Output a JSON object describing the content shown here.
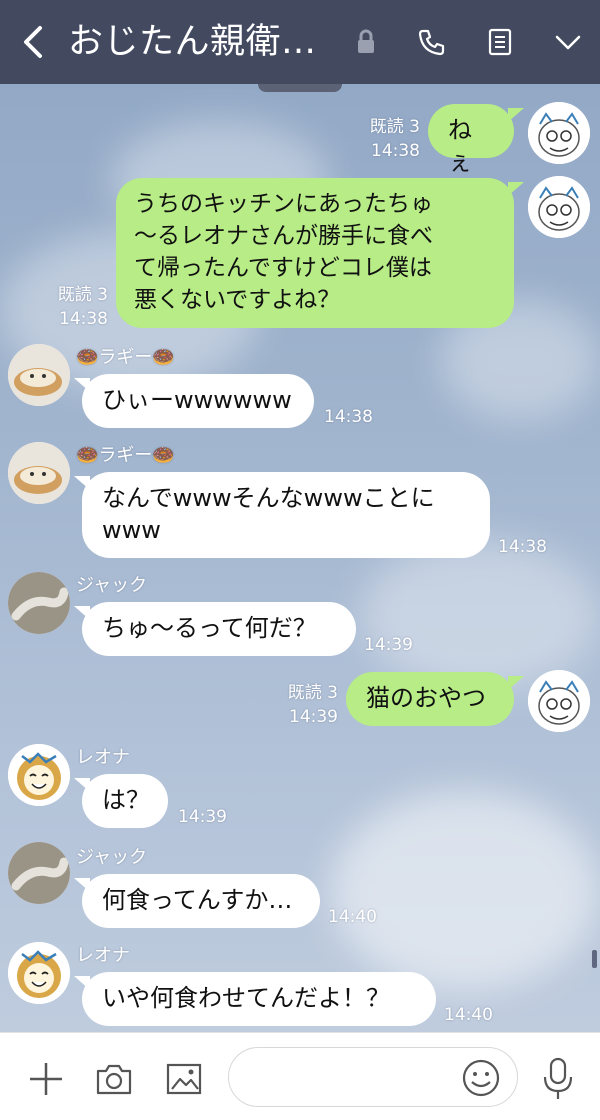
{
  "header": {
    "title": "おじたん親衛…",
    "icons": [
      "back-chevron-icon",
      "lock-icon",
      "phone-icon",
      "notes-icon",
      "chevron-down-icon"
    ],
    "bg_color": "#434a60"
  },
  "colors": {
    "outgoing_bubble": "#b7ec86",
    "incoming_bubble": "#ffffff"
  },
  "messages": [
    {
      "text": "ねぇ",
      "read": "既読 3",
      "time": "14:38"
    },
    {
      "text": "うちのキッチンにあったちゅ\n〜るレオナさんが勝手に食べ\nて帰ったんですけどコレ僕は\n悪くないですよね？",
      "read": "既読 3",
      "time": "14:38"
    },
    {
      "sender": "🍩ラギー🍩",
      "text": "ひぃーwwwwww",
      "time": "14:38"
    },
    {
      "sender": "🍩ラギー🍩",
      "text": "なんでwwwそんなwwwことに\nwww",
      "time": "14:38"
    },
    {
      "sender": "ジャック",
      "text": "ちゅ〜るって何だ？",
      "time": "14:39"
    },
    {
      "text": "猫のおやつ",
      "read": "既読 3",
      "time": "14:39"
    },
    {
      "sender": "レオナ",
      "text": "は？",
      "time": "14:39"
    },
    {
      "sender": "ジャック",
      "text": "何食ってんすか…",
      "time": "14:40"
    },
    {
      "sender": "レオナ",
      "text": "いや何食わせてんだよ！？",
      "time": "14:40"
    }
  ],
  "footer": {
    "icons": [
      "plus-icon",
      "camera-icon",
      "image-icon",
      "emoji-icon",
      "microphone-icon"
    ],
    "input_placeholder": ""
  }
}
